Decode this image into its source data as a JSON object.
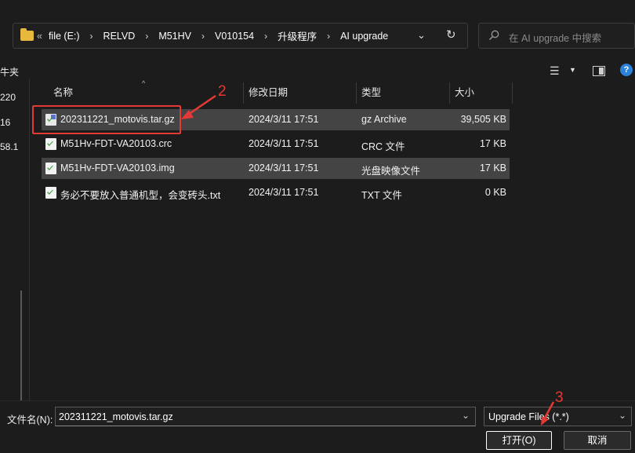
{
  "address_bar": {
    "overflow": "«",
    "crumbs": [
      "file (E:)",
      "RELVD",
      "M51HV",
      "V010154",
      "升级程序",
      "AI upgrade"
    ],
    "separator": "›",
    "chevron": "⌄",
    "refresh": "↻"
  },
  "search": {
    "placeholder": "在 AI upgrade 中搜索"
  },
  "left_pane": {
    "fragments": [
      "牛夹",
      "220",
      "16",
      "58.1"
    ]
  },
  "columns": {
    "name": "名称",
    "date": "修改日期",
    "type": "类型",
    "size": "大小"
  },
  "files": [
    {
      "name": "202311221_motovis.tar.gz",
      "date": "2024/3/11 17:51",
      "type": "gz Archive",
      "size": "39,505 KB",
      "selected": true,
      "icon": "archive-icon"
    },
    {
      "name": "M51Hv-FDT-VA20103.crc",
      "date": "2024/3/11 17:51",
      "type": "CRC 文件",
      "size": "17 KB",
      "selected": false,
      "icon": "file-icon"
    },
    {
      "name": "M51Hv-FDT-VA20103.img",
      "date": "2024/3/11 17:51",
      "type": "光盘映像文件",
      "size": "17 KB",
      "selected": true,
      "icon": "file-icon"
    },
    {
      "name": "务必不要放入普通机型，会变砖头.txt",
      "date": "2024/3/11 17:51",
      "type": "TXT 文件",
      "size": "0 KB",
      "selected": false,
      "icon": "file-icon"
    }
  ],
  "annotations": {
    "step2": "2",
    "step3": "3"
  },
  "bottom": {
    "filename_label": "文件名(N):",
    "filename_value": "202311221_motovis.tar.gz",
    "filetype": "Upgrade Files (*.*)",
    "open_label": "打开(O)",
    "cancel_label": "取消"
  },
  "colors": {
    "accent_annotation": "#e53935",
    "selection": "#444444",
    "background": "#1c1c1c"
  }
}
